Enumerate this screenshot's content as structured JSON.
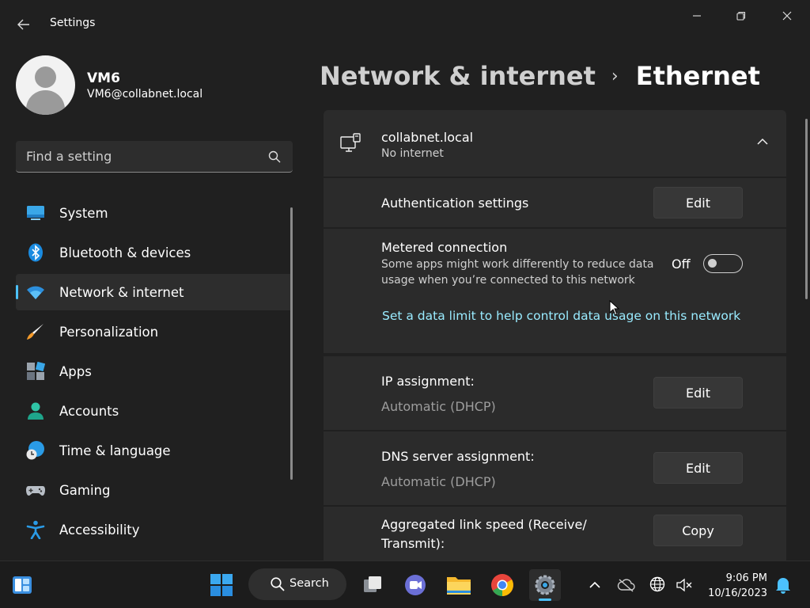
{
  "titlebar": {
    "app_title": "Settings",
    "back_icon": "back-arrow-icon",
    "controls": [
      "minimize-icon",
      "restore-icon",
      "close-icon"
    ]
  },
  "profile": {
    "name": "VM6",
    "email": "VM6@collabnet.local"
  },
  "search": {
    "placeholder": "Find a setting"
  },
  "nav": {
    "items": [
      {
        "label": "System",
        "icon": "system-icon"
      },
      {
        "label": "Bluetooth & devices",
        "icon": "bluetooth-icon"
      },
      {
        "label": "Network & internet",
        "icon": "wifi-icon",
        "active": true
      },
      {
        "label": "Personalization",
        "icon": "brush-icon"
      },
      {
        "label": "Apps",
        "icon": "apps-icon"
      },
      {
        "label": "Accounts",
        "icon": "accounts-icon"
      },
      {
        "label": "Time & language",
        "icon": "time-language-icon"
      },
      {
        "label": "Gaming",
        "icon": "gamepad-icon"
      },
      {
        "label": "Accessibility",
        "icon": "accessibility-icon"
      }
    ]
  },
  "header": {
    "parent": "Network & internet",
    "separator": "›",
    "current": "Ethernet"
  },
  "network": {
    "name": "collabnet.local",
    "status": "No internet"
  },
  "rows": {
    "auth": {
      "label": "Authentication settings",
      "button": "Edit"
    },
    "metered": {
      "label": "Metered connection",
      "description_line1": "Some apps might work differently to reduce data",
      "description_line2": "usage when you’re connected to this network",
      "toggle_state": "Off",
      "toggle_on": false,
      "link": "Set a data limit to help control data usage on this network"
    },
    "ip": {
      "label": "IP assignment:",
      "value": "Automatic (DHCP)",
      "button": "Edit"
    },
    "dns": {
      "label": "DNS server assignment:",
      "value": "Automatic (DHCP)",
      "button": "Edit"
    },
    "link_speed": {
      "label_line1": "Aggregated link speed (Receive/",
      "label_line2": "Transmit):",
      "button": "Copy"
    }
  },
  "taskbar": {
    "search_label": "Search",
    "time": "9:06 PM",
    "date": "10/16/2023",
    "icons": [
      "widgets-icon",
      "start-icon",
      "search-icon",
      "task-view-icon",
      "teams-chat-icon",
      "file-explorer-icon",
      "chrome-icon",
      "settings-icon",
      "chevron-up-icon",
      "onedrive-icon",
      "network-icon",
      "volume-muted-icon",
      "notification-bell-icon"
    ]
  },
  "colors": {
    "background": "#202020",
    "card": "#2b2b2b",
    "accent": "#4cc2ff",
    "link": "#99ebff"
  }
}
